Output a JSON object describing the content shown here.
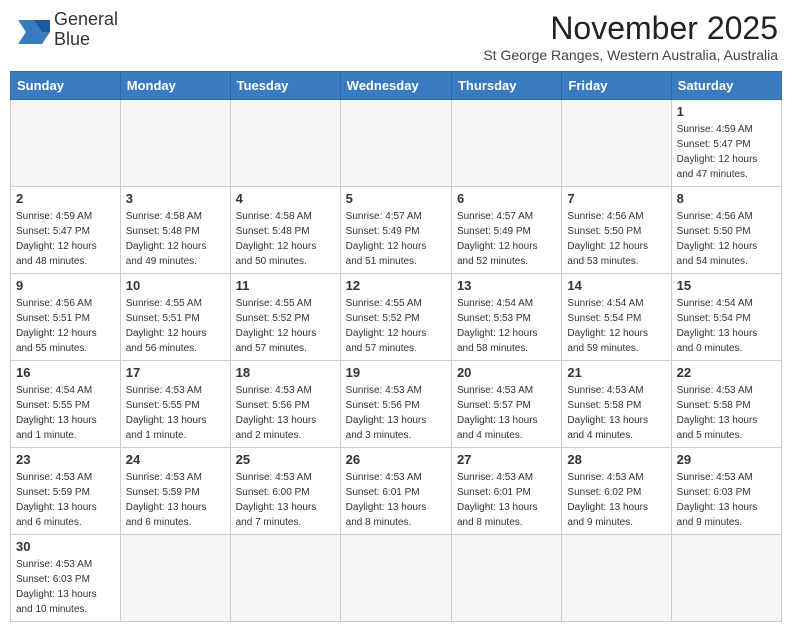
{
  "header": {
    "logo_line1": "General",
    "logo_line2": "Blue",
    "month_title": "November 2025",
    "location": "St George Ranges, Western Australia, Australia"
  },
  "weekdays": [
    "Sunday",
    "Monday",
    "Tuesday",
    "Wednesday",
    "Thursday",
    "Friday",
    "Saturday"
  ],
  "weeks": [
    [
      {
        "day": "",
        "info": ""
      },
      {
        "day": "",
        "info": ""
      },
      {
        "day": "",
        "info": ""
      },
      {
        "day": "",
        "info": ""
      },
      {
        "day": "",
        "info": ""
      },
      {
        "day": "",
        "info": ""
      },
      {
        "day": "1",
        "info": "Sunrise: 4:59 AM\nSunset: 5:47 PM\nDaylight: 12 hours\nand 47 minutes."
      }
    ],
    [
      {
        "day": "2",
        "info": "Sunrise: 4:59 AM\nSunset: 5:47 PM\nDaylight: 12 hours\nand 48 minutes."
      },
      {
        "day": "3",
        "info": "Sunrise: 4:58 AM\nSunset: 5:48 PM\nDaylight: 12 hours\nand 49 minutes."
      },
      {
        "day": "4",
        "info": "Sunrise: 4:58 AM\nSunset: 5:48 PM\nDaylight: 12 hours\nand 50 minutes."
      },
      {
        "day": "5",
        "info": "Sunrise: 4:57 AM\nSunset: 5:49 PM\nDaylight: 12 hours\nand 51 minutes."
      },
      {
        "day": "6",
        "info": "Sunrise: 4:57 AM\nSunset: 5:49 PM\nDaylight: 12 hours\nand 52 minutes."
      },
      {
        "day": "7",
        "info": "Sunrise: 4:56 AM\nSunset: 5:50 PM\nDaylight: 12 hours\nand 53 minutes."
      },
      {
        "day": "8",
        "info": "Sunrise: 4:56 AM\nSunset: 5:50 PM\nDaylight: 12 hours\nand 54 minutes."
      }
    ],
    [
      {
        "day": "9",
        "info": "Sunrise: 4:56 AM\nSunset: 5:51 PM\nDaylight: 12 hours\nand 55 minutes."
      },
      {
        "day": "10",
        "info": "Sunrise: 4:55 AM\nSunset: 5:51 PM\nDaylight: 12 hours\nand 56 minutes."
      },
      {
        "day": "11",
        "info": "Sunrise: 4:55 AM\nSunset: 5:52 PM\nDaylight: 12 hours\nand 57 minutes."
      },
      {
        "day": "12",
        "info": "Sunrise: 4:55 AM\nSunset: 5:52 PM\nDaylight: 12 hours\nand 57 minutes."
      },
      {
        "day": "13",
        "info": "Sunrise: 4:54 AM\nSunset: 5:53 PM\nDaylight: 12 hours\nand 58 minutes."
      },
      {
        "day": "14",
        "info": "Sunrise: 4:54 AM\nSunset: 5:54 PM\nDaylight: 12 hours\nand 59 minutes."
      },
      {
        "day": "15",
        "info": "Sunrise: 4:54 AM\nSunset: 5:54 PM\nDaylight: 13 hours\nand 0 minutes."
      }
    ],
    [
      {
        "day": "16",
        "info": "Sunrise: 4:54 AM\nSunset: 5:55 PM\nDaylight: 13 hours\nand 1 minute."
      },
      {
        "day": "17",
        "info": "Sunrise: 4:53 AM\nSunset: 5:55 PM\nDaylight: 13 hours\nand 1 minute."
      },
      {
        "day": "18",
        "info": "Sunrise: 4:53 AM\nSunset: 5:56 PM\nDaylight: 13 hours\nand 2 minutes."
      },
      {
        "day": "19",
        "info": "Sunrise: 4:53 AM\nSunset: 5:56 PM\nDaylight: 13 hours\nand 3 minutes."
      },
      {
        "day": "20",
        "info": "Sunrise: 4:53 AM\nSunset: 5:57 PM\nDaylight: 13 hours\nand 4 minutes."
      },
      {
        "day": "21",
        "info": "Sunrise: 4:53 AM\nSunset: 5:58 PM\nDaylight: 13 hours\nand 4 minutes."
      },
      {
        "day": "22",
        "info": "Sunrise: 4:53 AM\nSunset: 5:58 PM\nDaylight: 13 hours\nand 5 minutes."
      }
    ],
    [
      {
        "day": "23",
        "info": "Sunrise: 4:53 AM\nSunset: 5:59 PM\nDaylight: 13 hours\nand 6 minutes."
      },
      {
        "day": "24",
        "info": "Sunrise: 4:53 AM\nSunset: 5:59 PM\nDaylight: 13 hours\nand 6 minutes."
      },
      {
        "day": "25",
        "info": "Sunrise: 4:53 AM\nSunset: 6:00 PM\nDaylight: 13 hours\nand 7 minutes."
      },
      {
        "day": "26",
        "info": "Sunrise: 4:53 AM\nSunset: 6:01 PM\nDaylight: 13 hours\nand 8 minutes."
      },
      {
        "day": "27",
        "info": "Sunrise: 4:53 AM\nSunset: 6:01 PM\nDaylight: 13 hours\nand 8 minutes."
      },
      {
        "day": "28",
        "info": "Sunrise: 4:53 AM\nSunset: 6:02 PM\nDaylight: 13 hours\nand 9 minutes."
      },
      {
        "day": "29",
        "info": "Sunrise: 4:53 AM\nSunset: 6:03 PM\nDaylight: 13 hours\nand 9 minutes."
      }
    ],
    [
      {
        "day": "30",
        "info": "Sunrise: 4:53 AM\nSunset: 6:03 PM\nDaylight: 13 hours\nand 10 minutes."
      },
      {
        "day": "",
        "info": ""
      },
      {
        "day": "",
        "info": ""
      },
      {
        "day": "",
        "info": ""
      },
      {
        "day": "",
        "info": ""
      },
      {
        "day": "",
        "info": ""
      },
      {
        "day": "",
        "info": ""
      }
    ]
  ]
}
